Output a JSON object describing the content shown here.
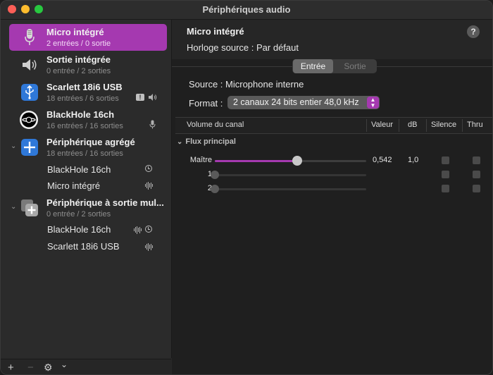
{
  "window": {
    "title": "Périphériques audio"
  },
  "sidebar": {
    "devices": [
      {
        "name": "Micro intégré",
        "sub": "2 entrées / 0 sortie",
        "icon": "microphone-icon",
        "selected": true
      },
      {
        "name": "Sortie intégrée",
        "sub": "0 entrée / 2 sorties",
        "icon": "speaker-icon"
      },
      {
        "name": "Scarlett 18i6 USB",
        "sub": "18 entrées / 6 sorties",
        "icon": "usb-icon",
        "badges": [
          "alert-icon",
          "speaker-icon"
        ]
      },
      {
        "name": "BlackHole 16ch",
        "sub": "16 entrées / 16 sorties",
        "icon": "blackhole-icon",
        "badges": [
          "microphone-icon"
        ]
      },
      {
        "name": "Périphérique agrégé",
        "sub": "18 entrées / 16 sorties",
        "icon": "aggregate-plus-icon",
        "children": [
          {
            "name": "BlackHole 16ch",
            "badges": [
              "clock-icon"
            ]
          },
          {
            "name": "Micro intégré",
            "badges": [
              "waveform-icon"
            ]
          }
        ]
      },
      {
        "name": "Périphérique à sortie mul...",
        "sub": "0 entrée / 2 sorties",
        "icon": "multi-output-icon",
        "children": [
          {
            "name": "BlackHole 16ch",
            "badges": [
              "waveform-icon",
              "clock-icon"
            ]
          },
          {
            "name": "Scarlett 18i6 USB",
            "badges": [
              "waveform-icon"
            ]
          }
        ]
      }
    ],
    "bottom": {
      "add": "+",
      "remove": "−",
      "settings": "⚙",
      "menu": "⌄"
    }
  },
  "detail": {
    "title": "Micro intégré",
    "clock_source": "Horloge source :  Par défaut",
    "help": "?",
    "tabs": [
      {
        "label": "Entrée",
        "active": true
      },
      {
        "label": "Sortie",
        "active": false
      }
    ],
    "source": "Source :  Microphone interne",
    "format_label": "Format :",
    "format_value": "2 canaux 24 bits entier 48,0 kHz",
    "columns": [
      "Volume du canal",
      "Valeur",
      "dB",
      "Silence",
      "Thru"
    ],
    "group": "Flux principal",
    "channels": [
      {
        "label": "Maître",
        "value": "0,542",
        "db": "1,0",
        "level": 0.542
      },
      {
        "label": "1",
        "value": "",
        "db": "",
        "level": 0
      },
      {
        "label": "2",
        "value": "",
        "db": "",
        "level": 0
      }
    ]
  },
  "colors": {
    "accent": "#a539b0",
    "background": "#1f1f1f",
    "sidebar": "#2b2b2b"
  }
}
